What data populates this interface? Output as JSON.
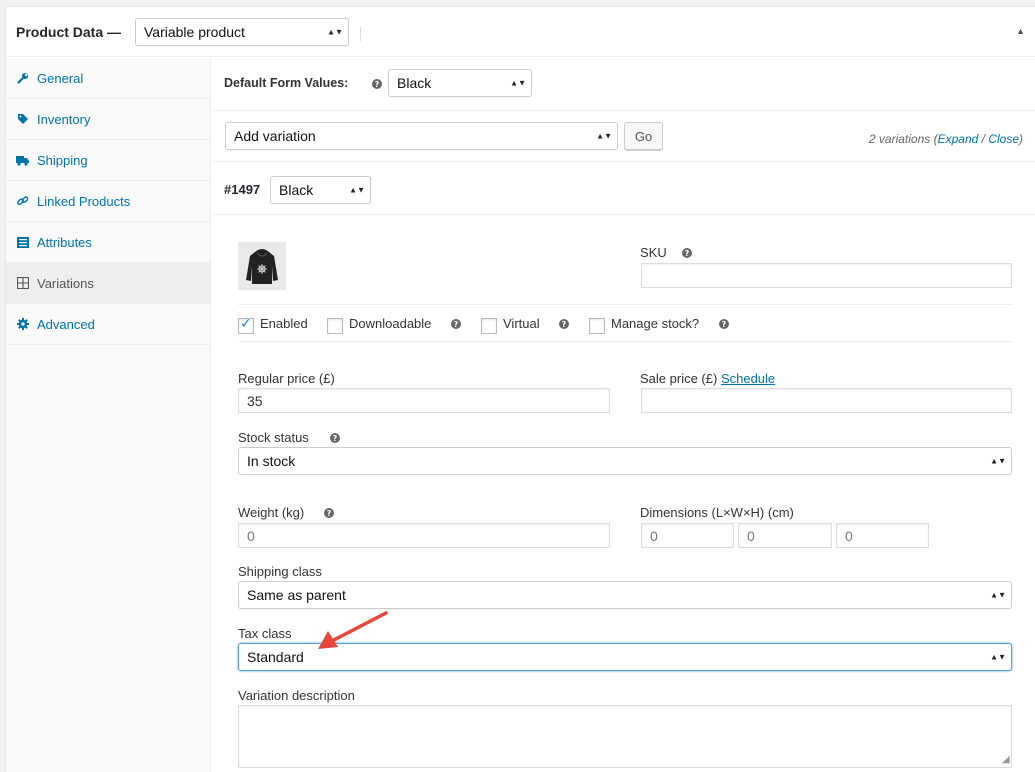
{
  "header": {
    "title": "Product Data —",
    "product_type": "Variable product"
  },
  "sidebar": {
    "items": [
      {
        "label": "General",
        "icon": "wrench-icon"
      },
      {
        "label": "Inventory",
        "icon": "tag-icon"
      },
      {
        "label": "Shipping",
        "icon": "truck-icon"
      },
      {
        "label": "Linked Products",
        "icon": "link-icon"
      },
      {
        "label": "Attributes",
        "icon": "list-icon"
      },
      {
        "label": "Variations",
        "icon": "grid-icon",
        "active": true
      },
      {
        "label": "Advanced",
        "icon": "gear-icon"
      }
    ]
  },
  "defaults": {
    "label": "Default Form Values:",
    "value": "Black"
  },
  "actions": {
    "select_value": "Add variation",
    "go_label": "Go",
    "count_text": "2 variations (",
    "expand": "Expand",
    "sep": " / ",
    "close": "Close",
    "end": ")"
  },
  "variation": {
    "id": "#1497",
    "attribute_value": "Black",
    "sku_label": "SKU",
    "sku_value": "",
    "enabled_label": "Enabled",
    "enabled": true,
    "downloadable_label": "Downloadable",
    "virtual_label": "Virtual",
    "manage_stock_label": "Manage stock?",
    "regular_price_label": "Regular price (£)",
    "regular_price": "35",
    "sale_price_label": "Sale price (£)",
    "schedule_label": "Schedule",
    "sale_price": "",
    "stock_status_label": "Stock status",
    "stock_status": "In stock",
    "weight_label": "Weight (kg)",
    "weight_placeholder": "0",
    "dimensions_label": "Dimensions (L×W×H) (cm)",
    "dim_l": "0",
    "dim_w": "0",
    "dim_h": "0",
    "shipping_class_label": "Shipping class",
    "shipping_class": "Same as parent",
    "tax_class_label": "Tax class",
    "tax_class": "Standard",
    "description_label": "Variation description",
    "description": ""
  },
  "colors": {
    "link": "#0073aa",
    "annotation_arrow": "#e8463c"
  }
}
